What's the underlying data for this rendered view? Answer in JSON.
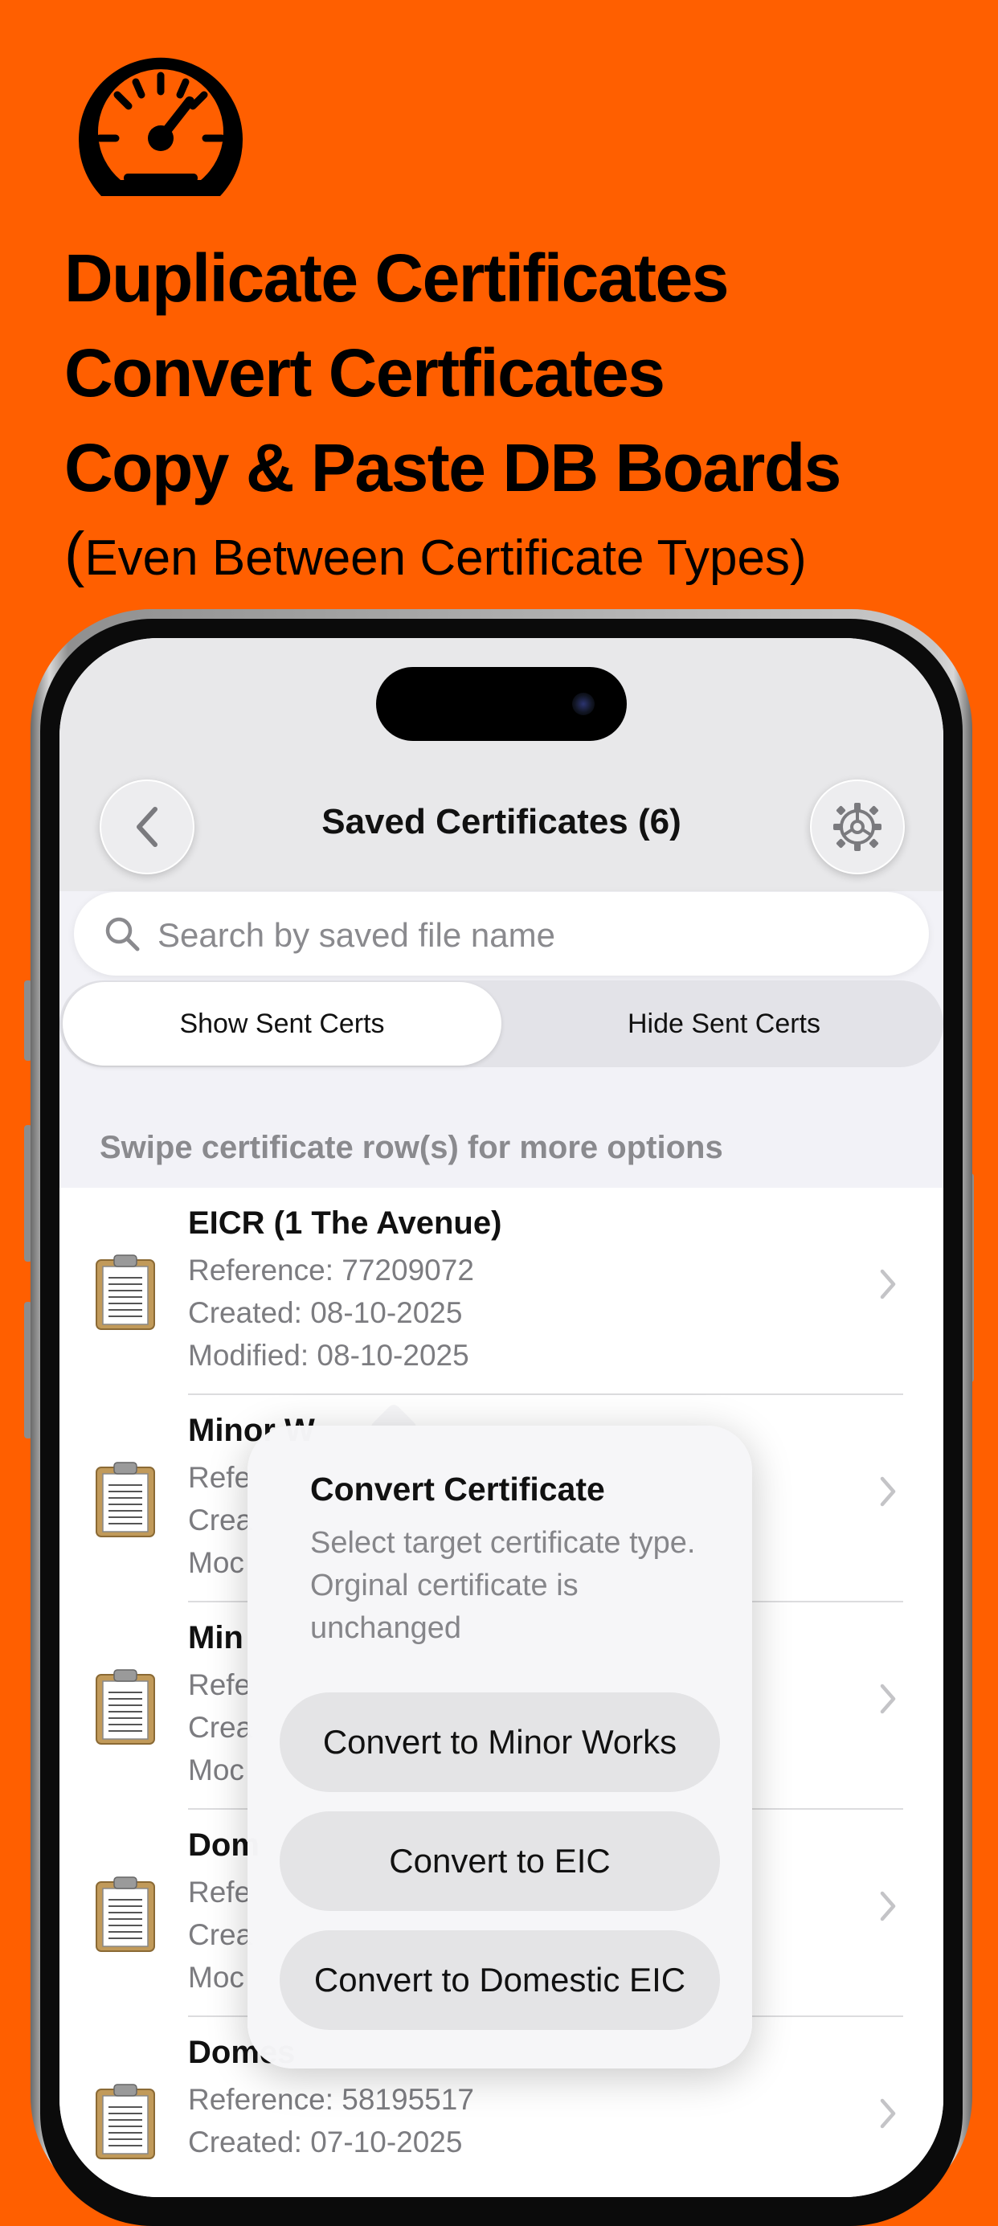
{
  "promo": {
    "line1": "Duplicate Certificates",
    "line2": "Convert Certficates",
    "line3": "Copy & Paste DB Boards",
    "sub_paren": "(",
    "sub_text": "Even Between Certificate Types)"
  },
  "nav": {
    "title": "Saved Certificates (6)"
  },
  "search": {
    "placeholder": "Search by saved file name"
  },
  "filter": {
    "show_label": "Show Sent Certs",
    "hide_label": "Hide Sent Certs",
    "selected": "Show Sent Certs"
  },
  "hint": "Swipe certificate row(s) for more options",
  "certificates": [
    {
      "title": "EICR (1 The Avenue)",
      "reference": "Reference: 77209072",
      "created": "Created: 08-10-2025",
      "modified": "Modified: 08-10-2025"
    },
    {
      "title": "Minor W",
      "reference": "Refe",
      "created": "Crea",
      "modified": "Moc"
    },
    {
      "title": "Min",
      "reference": "Refe",
      "created": "Crea",
      "modified": "Moc"
    },
    {
      "title": "Dom",
      "reference": "Refe",
      "created": "Crea",
      "modified": "Moc"
    },
    {
      "title": "Domes",
      "reference": "Reference: 58195517",
      "created": "Created: 07-10-2025",
      "modified": ""
    }
  ],
  "popover": {
    "title": "Convert Certificate",
    "description": "Select target certificate type. Orginal certificate is unchanged",
    "options": [
      "Convert to Minor Works",
      "Convert to EIC",
      "Convert to Domestic EIC"
    ]
  },
  "icons": {
    "logo": "speedometer-icon",
    "back": "chevron-left-icon",
    "settings": "gear-icon",
    "search": "search-icon",
    "row": "clipboard-document-icon",
    "disclosure": "chevron-right-icon"
  },
  "colors": {
    "background": "#FF5F00",
    "text": "#000000"
  }
}
